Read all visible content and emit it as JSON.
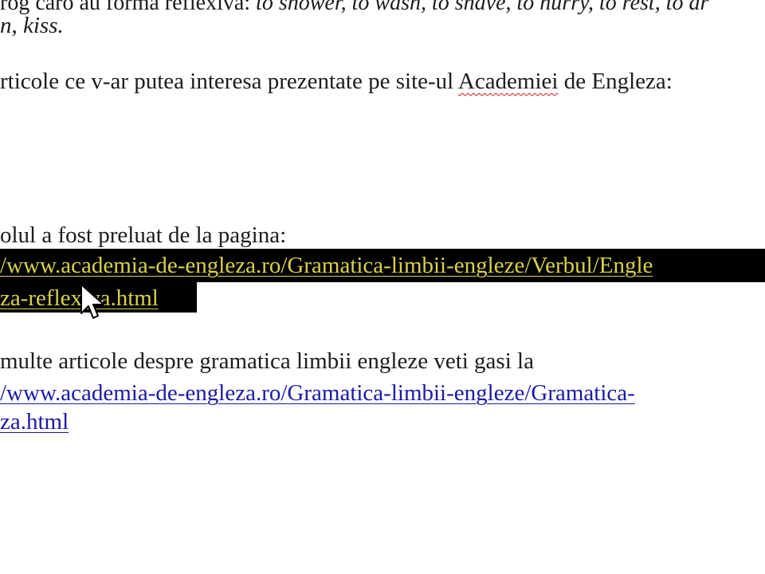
{
  "doc": {
    "line1_prefix": "rog caro au forma reflexiva: ",
    "line1_italic": "to shower, to wash, to shave, to hurry, to rest, to dr",
    "line2_italic": "n, kiss.",
    "line3_prefix": "rticole ce v-ar putea interesa prezentate pe site-ul ",
    "line3_word_academiei": "Academiei",
    "line3_suffix": " de Engleza:",
    "line4_text": "olul a fost preluat de la pagina:",
    "link1_line1": "/www.academia-de-engleza.ro/Gramatica-limbii-engleze/Verbul/Engle",
    "link1_line2": "za-reflexiva.html",
    "line5_text": "multe articole despre gramatica limbii engleze veti gasi la",
    "link2_line1": "/www.academia-de-engleza.ro/Gramatica-limbii-engleze/Gramatica-",
    "link2_line2": "za.html"
  },
  "colors": {
    "selection_background": "#000000",
    "selection_text": "#d8d24a",
    "link_text": "#1a1aa6",
    "spellcheck_underline": "#d11a1a"
  },
  "icons": {
    "cursor": "mouse-pointer-arrow-icon"
  }
}
